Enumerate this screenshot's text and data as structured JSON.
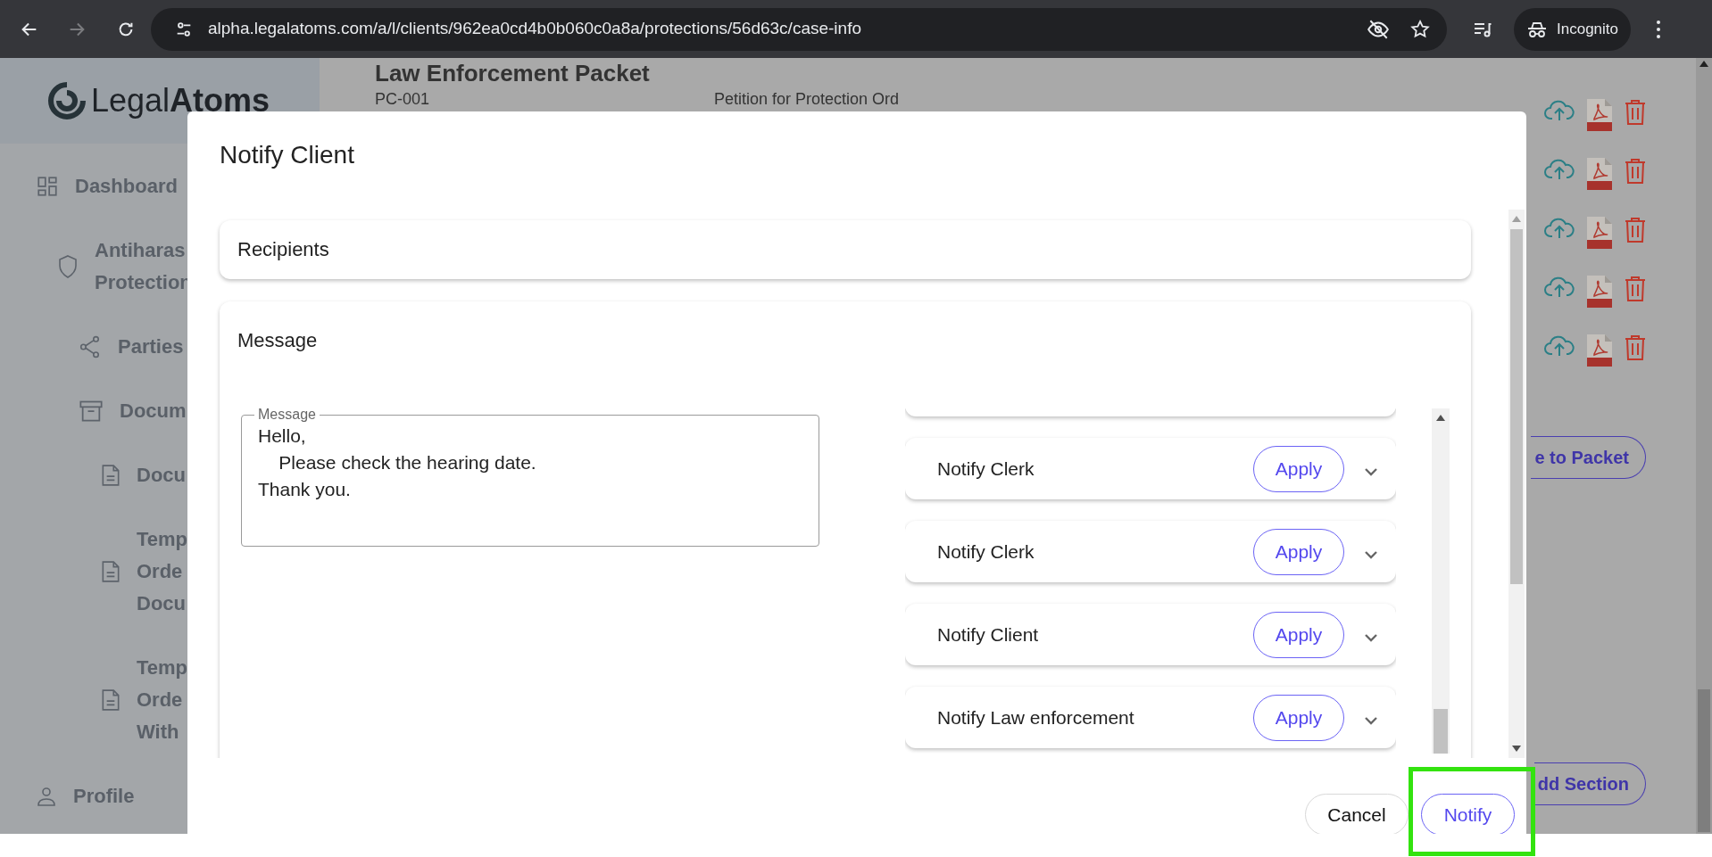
{
  "browser": {
    "url": "alpha.legalatoms.com/a/l/clients/962ea0cd4b0b060c0a8a/protections/56d63c/case-info",
    "profile": "Incognito"
  },
  "logo": "Legal**Atoms**",
  "sidebar": {
    "items": [
      {
        "kind": "grid",
        "lines": [
          "Dashboard"
        ],
        "children": [
          {
            "kind": "shield",
            "lines": [
              "Antiharas",
              "Protection"
            ],
            "children": [
              {
                "kind": "share",
                "lines": [
                  "Parties"
                ]
              },
              {
                "kind": "archive",
                "lines": [
                  "Docum"
                ],
                "children": [
                  {
                    "kind": "file",
                    "lines": [
                      "Docu"
                    ]
                  },
                  {
                    "kind": "file",
                    "lines": [
                      "Temp",
                      "Orde",
                      "Docu"
                    ]
                  },
                  {
                    "kind": "file",
                    "lines": [
                      "Temp",
                      "Orde",
                      "With"
                    ]
                  }
                ]
              }
            ]
          }
        ]
      },
      {
        "kind": "person",
        "lines": [
          "Profile"
        ]
      }
    ]
  },
  "page": {
    "heading": "Law Enforcement Packet",
    "row": {
      "code": "PC-001",
      "title": "Petition for Protection Ord"
    },
    "row_actions": [
      {
        "kind": "file"
      },
      {
        "kind": "file"
      },
      {
        "kind": "file"
      },
      {
        "kind": "file"
      },
      {
        "kind": "file"
      }
    ],
    "buttons": [
      "e to Packet",
      "dd Section"
    ]
  },
  "modal": {
    "title": "Notify Client",
    "sections": [
      {
        "title": "Recipients"
      },
      {
        "title": "Message"
      }
    ],
    "message_field": {
      "label": "Message",
      "value": "Hello,\n    Please check the hearing date.\nThank you."
    },
    "templates": [
      {
        "name": "Notify Clerk",
        "action": "Apply"
      },
      {
        "name": "Notify Clerk",
        "action": "Apply"
      },
      {
        "name": "Notify Client",
        "action": "Apply"
      },
      {
        "name": "Notify Law enforcement",
        "action": "Apply"
      }
    ],
    "buttons": [
      {
        "label": "Cancel",
        "kind": "secondary",
        "highlighted": false
      },
      {
        "label": "Notify",
        "kind": "primary",
        "highlighted": true
      }
    ]
  }
}
